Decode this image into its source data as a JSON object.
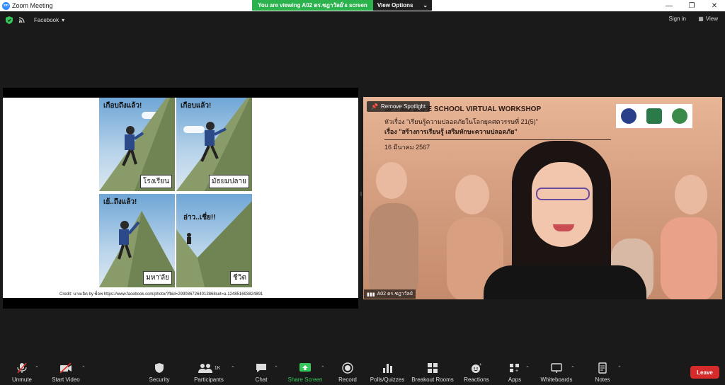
{
  "window": {
    "title": "Zoom Meeting",
    "app_icon_text": "zm",
    "controls": [
      "minimize-icon",
      "maximize-icon",
      "close-icon"
    ]
  },
  "share_banner": {
    "viewing_text": "You are viewing A02 ดร.ชฎาวัลย์'s screen",
    "view_options_label": "View Options"
  },
  "topbar": {
    "app_name": "Facebook",
    "sign_in_label": "Sign in",
    "view_label": "View"
  },
  "shared_screen": {
    "panels": [
      {
        "speech": "เกือบถึงแล้ว!",
        "caption": "โรงเรียน"
      },
      {
        "speech": "เกือบแล้ว!",
        "caption": "มัธยมปลาย"
      },
      {
        "speech": "เย้..ถึงแล้ว!",
        "caption": "มหา'ลัย"
      },
      {
        "speech": "อ่าว..เชี่ย!!",
        "caption": "ชีวิต"
      }
    ],
    "credit": "Credit: นายเอิด by พี่อพ https://www.facebook.com/photo/?fbid=2990867264013868set=a.124851693824891"
  },
  "video": {
    "remove_spotlight_label": "Remove Spotlight",
    "workshop_title": "SP - MU SAFE SCHOOL VIRTUAL WORKSHOP",
    "line1": "หัวเรื่อง \"เรียนรู้ความปลอดภัยในโลกยุคศตวรรษที่ 21(5)\"",
    "line2": "เรื่อง \"สร้างการเรียนรู้ เสริมทักษะความปลอดภัย\"",
    "date": "16 มีนาคม 2567",
    "participant_name": "A02 ดร.ชฎาวัลย์"
  },
  "toolbar": {
    "unmute": "Unmute",
    "start_video": "Start Video",
    "security": "Security",
    "participants": "Participants",
    "participants_count": "1K",
    "chat": "Chat",
    "share_screen": "Share Screen",
    "record": "Record",
    "polls": "Polls/Quizzes",
    "breakout": "Breakout Rooms",
    "reactions": "Reactions",
    "apps": "Apps",
    "whiteboards": "Whiteboards",
    "notes": "Notes",
    "leave": "Leave"
  },
  "colors": {
    "accent_green": "#2bb24c",
    "leave_red": "#d62b2b",
    "zoom_blue": "#2d8cff"
  }
}
